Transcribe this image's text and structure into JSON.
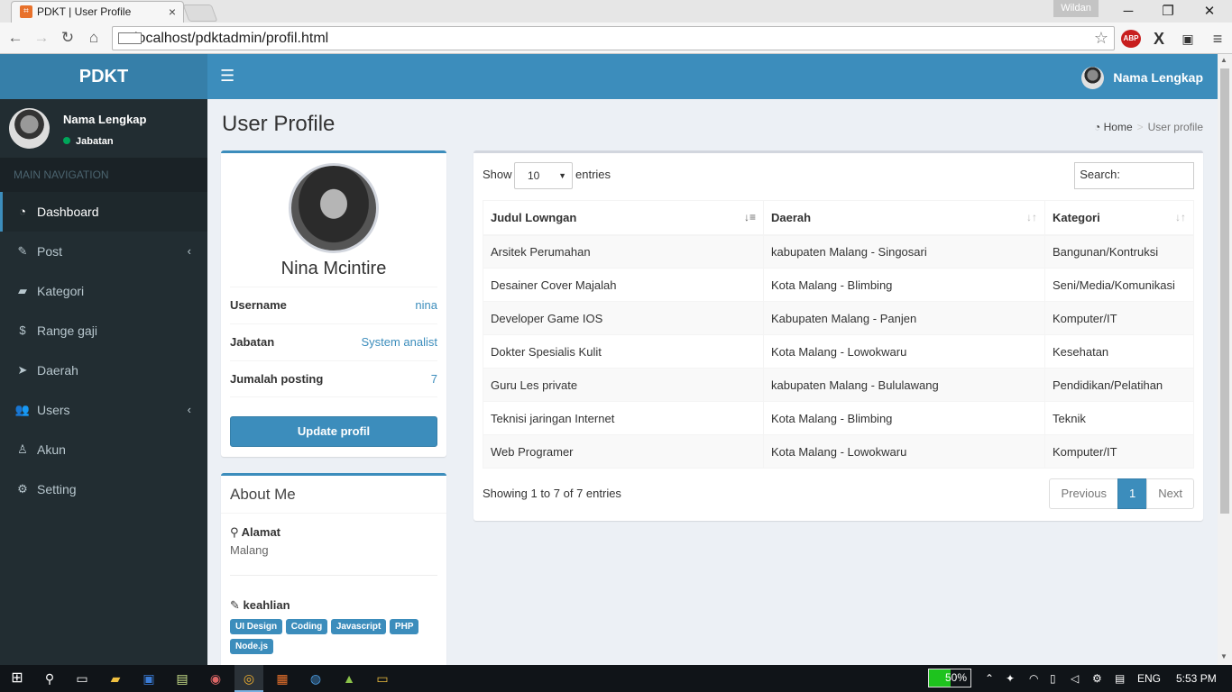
{
  "browser": {
    "tab_title": "PDKT | User Profile",
    "tab_close": "×",
    "os_user": "Wildan",
    "url": "localhost/pdktadmin/profil.html",
    "window_buttons": {
      "minimize": "─",
      "restore": "❐",
      "close": "✕"
    },
    "nav_icons": {
      "back": "←",
      "forward": "→",
      "reload": "↻",
      "home": "⌂"
    },
    "extensions": [
      "ABP",
      "X"
    ]
  },
  "app": {
    "logo": "PDKT",
    "header_user": "Nama Lengkap",
    "colors": {
      "primary": "#3c8dbc",
      "sidebar": "#222d32",
      "online": "#00a65a"
    }
  },
  "sidebar": {
    "user_name": "Nama Lengkap",
    "user_status": "Jabatan",
    "nav_header": "MAIN NAVIGATION",
    "items": [
      {
        "label": "Dashboard",
        "icon": "dashboard-icon",
        "active": true
      },
      {
        "label": "Post",
        "icon": "edit-icon",
        "has_children": true
      },
      {
        "label": "Kategori",
        "icon": "folder-icon"
      },
      {
        "label": "Range gaji",
        "icon": "dollar-icon"
      },
      {
        "label": "Daerah",
        "icon": "location-arrow-icon"
      },
      {
        "label": "Users",
        "icon": "users-icon",
        "has_children": true
      },
      {
        "label": "Akun",
        "icon": "person-icon"
      },
      {
        "label": "Setting",
        "icon": "gears-icon"
      }
    ]
  },
  "page": {
    "title": "User Profile",
    "breadcrumb": {
      "home": "Home",
      "current": "User profile"
    }
  },
  "profile": {
    "name": "Nina Mcintire",
    "fields": [
      {
        "label": "Username",
        "value": "nina"
      },
      {
        "label": "Jabatan",
        "value": "System analist"
      },
      {
        "label": "Jumalah posting",
        "value": "7"
      }
    ],
    "update_button": "Update profil"
  },
  "about": {
    "title": "About Me",
    "address_label": "Alamat",
    "address_value": "Malang",
    "skills_label": "keahlian",
    "skills": [
      "UI Design",
      "Coding",
      "Javascript",
      "PHP",
      "Node.js"
    ]
  },
  "table": {
    "show_label": "Show",
    "length_value": "10",
    "entries_label": "entries",
    "search_label": "Search:",
    "search_value": "",
    "columns": [
      "Judul Lowngan",
      "Daerah",
      "Kategori"
    ],
    "rows": [
      [
        "Arsitek Perumahan",
        "kabupaten Malang - Singosari",
        "Bangunan/Kontruksi"
      ],
      [
        "Desainer Cover Majalah",
        "Kota Malang - Blimbing",
        "Seni/Media/Komunikasi"
      ],
      [
        "Developer Game IOS",
        "Kabupaten Malang - Panjen",
        "Komputer/IT"
      ],
      [
        "Dokter Spesialis Kulit",
        "Kota Malang - Lowokwaru",
        "Kesehatan"
      ],
      [
        "Guru Les private",
        "kabupaten Malang - Bululawang",
        "Pendidikan/Pelatihan"
      ],
      [
        "Teknisi jaringan Internet",
        "Kota Malang - Blimbing",
        "Teknik"
      ],
      [
        "Web Programer",
        "Kota Malang - Lowokwaru",
        "Komputer/IT"
      ]
    ],
    "info": "Showing 1 to 7 of 7 entries",
    "pagination": {
      "previous": "Previous",
      "page": "1",
      "next": "Next"
    }
  },
  "taskbar": {
    "battery": "50%",
    "language": "ENG",
    "time": "5:53 PM"
  }
}
